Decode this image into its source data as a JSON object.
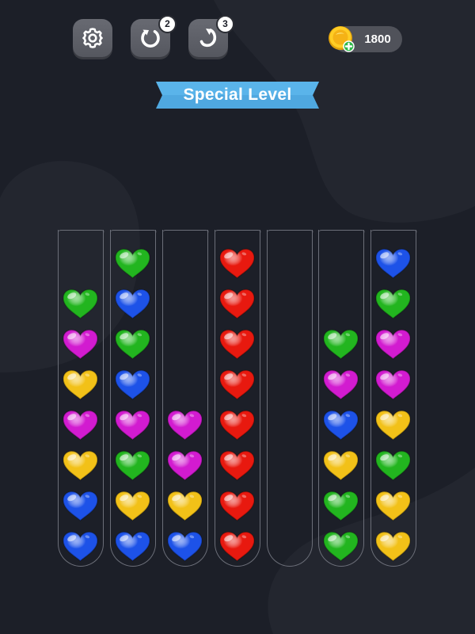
{
  "toolbar": {
    "restart_count": "2",
    "undo_count": "3",
    "coins": "1800"
  },
  "banner": {
    "title": "Special Level"
  },
  "colors": {
    "green": "#22b51f",
    "blue": "#1d52e8",
    "magenta": "#d21bd0",
    "yellow": "#f2c118",
    "red": "#e8190f"
  },
  "tubes": [
    [
      "blue",
      "blue",
      "yellow",
      "magenta",
      "yellow",
      "magenta",
      "green"
    ],
    [
      "blue",
      "yellow",
      "green",
      "magenta",
      "blue",
      "green",
      "blue",
      "green"
    ],
    [
      "blue",
      "yellow",
      "magenta",
      "magenta"
    ],
    [
      "red",
      "red",
      "red",
      "red",
      "red",
      "red",
      "red",
      "red"
    ],
    [],
    [
      "green",
      "green",
      "yellow",
      "blue",
      "magenta",
      "green"
    ],
    [
      "yellow",
      "yellow",
      "green",
      "yellow",
      "magenta",
      "magenta",
      "green",
      "blue"
    ]
  ]
}
